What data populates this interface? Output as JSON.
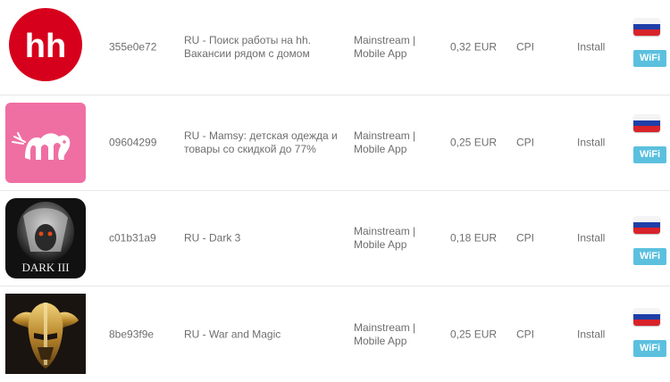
{
  "offers": [
    {
      "icon": "hh-logo-icon",
      "icon_text": "hh",
      "id": "355e0e72",
      "name": "RU - Поиск работы на hh. Вакансии рядом с домом",
      "category": "Mainstream | Mobile App",
      "payout": "0,32 EUR",
      "model": "CPI",
      "action": "Install",
      "country_flag": "ru-flag-icon",
      "network": "WiFi"
    },
    {
      "icon": "mamsy-logo-icon",
      "id": "09604299",
      "name": "RU - Mamsy: детская одежда и товары со скидкой до 77%",
      "category": "Mainstream | Mobile App",
      "payout": "0,25 EUR",
      "model": "CPI",
      "action": "Install",
      "country_flag": "ru-flag-icon",
      "network": "WiFi"
    },
    {
      "icon": "dark-3-game-icon",
      "icon_text": "DARK III",
      "id": "c01b31a9",
      "name": "RU - Dark 3",
      "category": "Mainstream | Mobile App",
      "payout": "0,18 EUR",
      "model": "CPI",
      "action": "Install",
      "country_flag": "ru-flag-icon",
      "network": "WiFi"
    },
    {
      "icon": "war-and-magic-game-icon",
      "id": "8be93f9e",
      "name": "RU - War and Magic",
      "category": "Mainstream | Mobile App",
      "payout": "0,25 EUR",
      "model": "CPI",
      "action": "Install",
      "country_flag": "ru-flag-icon",
      "network": "WiFi"
    }
  ],
  "colors": {
    "wifi_badge": "#5bc0de",
    "hh_red": "#d6001c",
    "mamsy_pink": "#ef6fa3",
    "flag_white": "#f4f4f4",
    "flag_blue": "#1f3fa8",
    "flag_red": "#d8232a"
  }
}
